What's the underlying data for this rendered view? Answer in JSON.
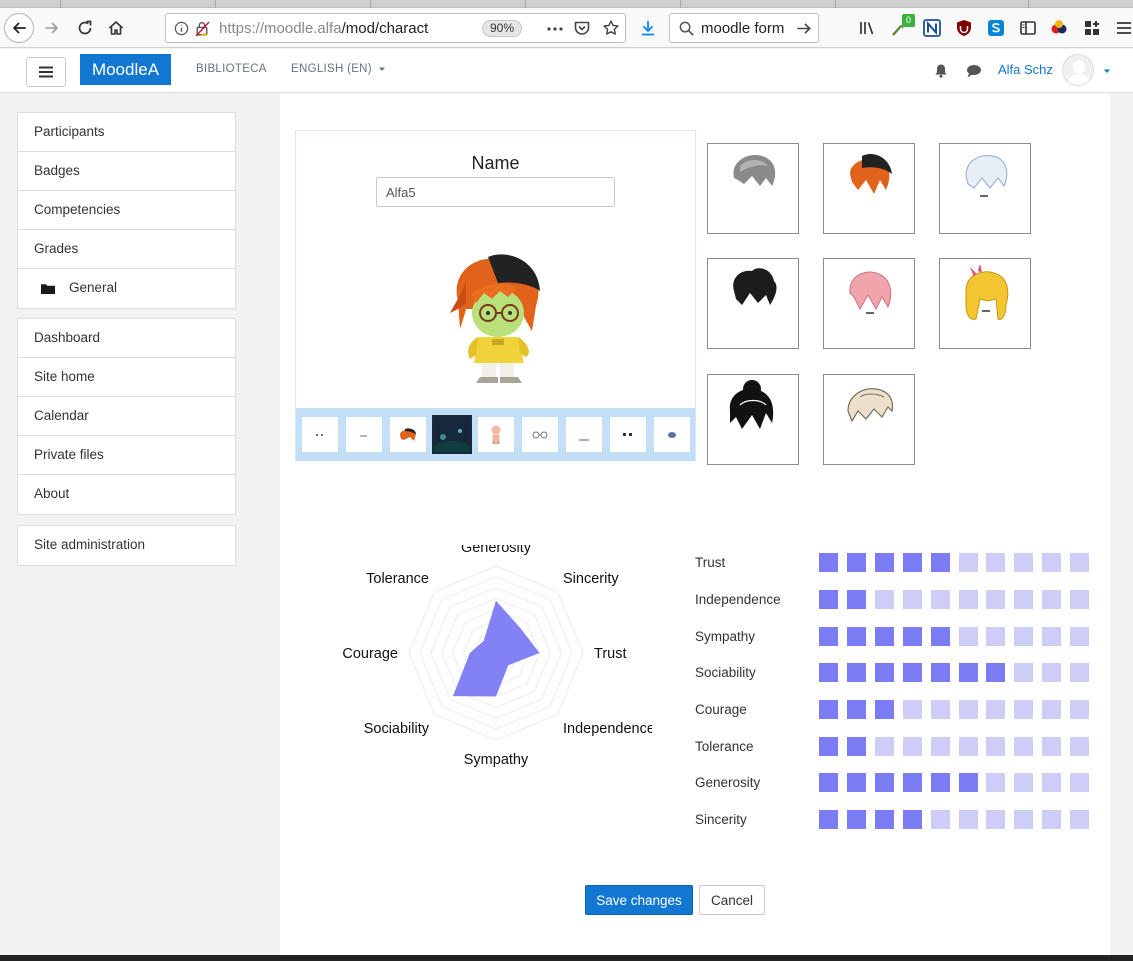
{
  "browser": {
    "url_host": "https://moodle.alfa",
    "url_path": "/mod/charact",
    "zoom": "90%",
    "search_text": "moodle form",
    "ext_badge": "0"
  },
  "navbar": {
    "brand": "MoodleA",
    "links": [
      "BIBLIOTECA",
      "ENGLISH (EN)"
    ],
    "user_name": "Alfa Schz"
  },
  "drawer": {
    "course_items": [
      "Participants",
      "Badges",
      "Competencies",
      "Grades",
      "General"
    ],
    "site_items": [
      "Dashboard",
      "Site home",
      "Calendar",
      "Private files",
      "About"
    ],
    "admin_items": [
      "Site administration"
    ]
  },
  "character": {
    "name_label": "Name",
    "name_value": "Alfa5",
    "thumbnails": [
      "face-thumb",
      "eye-thumb",
      "hair-thumb",
      "background-thumb",
      "body-thumb",
      "glasses-thumb",
      "hat-thumb",
      "eyes-thumb",
      "item-thumb"
    ],
    "selected_thumbnail": 3,
    "hair_options": [
      {
        "icon": "grey-hair-icon",
        "color": "#8a8a8a"
      },
      {
        "icon": "orange-hair-icon",
        "color": "#e0621b"
      },
      {
        "icon": "white-hair-icon",
        "color": "#dfe8f2"
      },
      {
        "icon": "black-curly-hair-icon",
        "color": "#1c1c1c"
      },
      {
        "icon": "pink-hair-icon",
        "color": "#f2a4ad"
      },
      {
        "icon": "blonde-hair-icon",
        "color": "#f3c531"
      },
      {
        "icon": "black-bun-hair-icon",
        "color": "#111111"
      },
      {
        "icon": "cream-hair-icon",
        "color": "#ece0cc"
      }
    ]
  },
  "chart_data": {
    "type": "radar",
    "axes": [
      "Generosity",
      "Sincerity",
      "Trust",
      "Independence",
      "Sympathy",
      "Sociability",
      "Courage",
      "Tolerance"
    ],
    "values": [
      6,
      4,
      5,
      2,
      5,
      7,
      3,
      2
    ],
    "max": 10,
    "fill_color": "#7b7bf4"
  },
  "traits": {
    "max": 10,
    "filled_color": "#7b7bf4",
    "empty_color": "#cdcdf8",
    "rows": [
      {
        "name": "Trust",
        "value": 5
      },
      {
        "name": "Independence",
        "value": 2
      },
      {
        "name": "Sympathy",
        "value": 5
      },
      {
        "name": "Sociability",
        "value": 7
      },
      {
        "name": "Courage",
        "value": 3
      },
      {
        "name": "Tolerance",
        "value": 2
      },
      {
        "name": "Generosity",
        "value": 6
      },
      {
        "name": "Sincerity",
        "value": 4
      }
    ]
  },
  "actions": {
    "save_label": "Save changes",
    "cancel_label": "Cancel"
  }
}
